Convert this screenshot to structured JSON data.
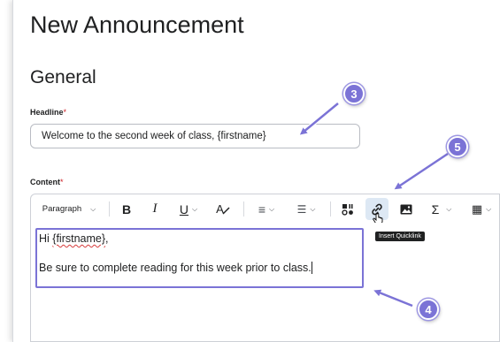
{
  "page": {
    "title": "New Announcement"
  },
  "section": {
    "title": "General"
  },
  "headline": {
    "label": "Headline",
    "required_mark": "*",
    "value": "Welcome to the second week of class, {firstname}"
  },
  "content": {
    "label": "Content",
    "required_mark": "*",
    "toolbar": {
      "paragraph_select": "Paragraph",
      "bold": "B",
      "italic": "I",
      "underline": "U",
      "font_color": "A",
      "align": "≡",
      "list": "☰",
      "media": "▦",
      "insert_quicklink": "link",
      "image": "image",
      "equation": "Σ",
      "table": "▦"
    },
    "tooltip": "Insert Quicklink",
    "body": {
      "line1_prefix": "Hi ",
      "line1_token": "{firstname}",
      "line1_suffix": ",",
      "line2": "Be sure to complete reading for this week prior to class."
    }
  },
  "callouts": [
    "3",
    "4",
    "5"
  ],
  "colors": {
    "callout": "#7b73d6",
    "highlight_box": "#7b73d6",
    "required": "#cd2026"
  }
}
